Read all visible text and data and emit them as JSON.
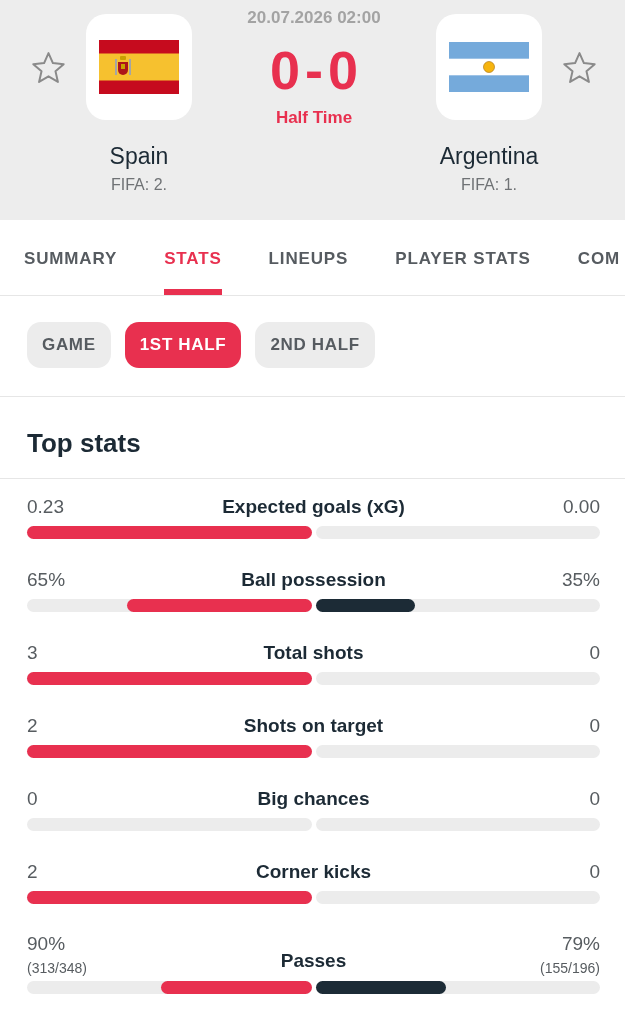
{
  "match": {
    "datetime": "20.07.2026 02:00",
    "score": "0-0",
    "status": "Half Time",
    "home": {
      "name": "Spain",
      "ranking": "FIFA: 2.",
      "favorite": false
    },
    "away": {
      "name": "Argentina",
      "ranking": "FIFA: 1.",
      "favorite": false
    }
  },
  "tabs": [
    {
      "label": "SUMMARY",
      "selected": false
    },
    {
      "label": "STATS",
      "selected": true
    },
    {
      "label": "LINEUPS",
      "selected": false
    },
    {
      "label": "PLAYER STATS",
      "selected": false
    },
    {
      "label": "COM",
      "selected": false
    }
  ],
  "periods": [
    {
      "label": "GAME",
      "selected": false
    },
    {
      "label": "1ST HALF",
      "selected": true
    },
    {
      "label": "2ND HALF",
      "selected": false
    }
  ],
  "top_stats": {
    "title": "Top stats",
    "rows": [
      {
        "label": "Expected goals (xG)",
        "home": {
          "value": "0.23",
          "level": 1
        },
        "away": {
          "value": "0.00",
          "level": 0
        }
      },
      {
        "label": "Ball possession",
        "home": {
          "value": "65%",
          "level": 0.65
        },
        "away": {
          "value": "35%",
          "level": 0.35
        }
      },
      {
        "label": "Total shots",
        "home": {
          "value": "3",
          "level": 1
        },
        "away": {
          "value": "0",
          "level": 0
        }
      },
      {
        "label": "Shots on target",
        "home": {
          "value": "2",
          "level": 1
        },
        "away": {
          "value": "0",
          "level": 0
        }
      },
      {
        "label": "Big chances",
        "home": {
          "value": "0",
          "level": 0
        },
        "away": {
          "value": "0",
          "level": 0
        }
      },
      {
        "label": "Corner kicks",
        "home": {
          "value": "2",
          "level": 1
        },
        "away": {
          "value": "0",
          "level": 0
        }
      },
      {
        "label": "Passes",
        "home": {
          "value": "90%",
          "detail": "(313/348)",
          "level": 0.53
        },
        "away": {
          "value": "79%",
          "detail": "(155/196)",
          "level": 0.46
        }
      }
    ]
  }
}
